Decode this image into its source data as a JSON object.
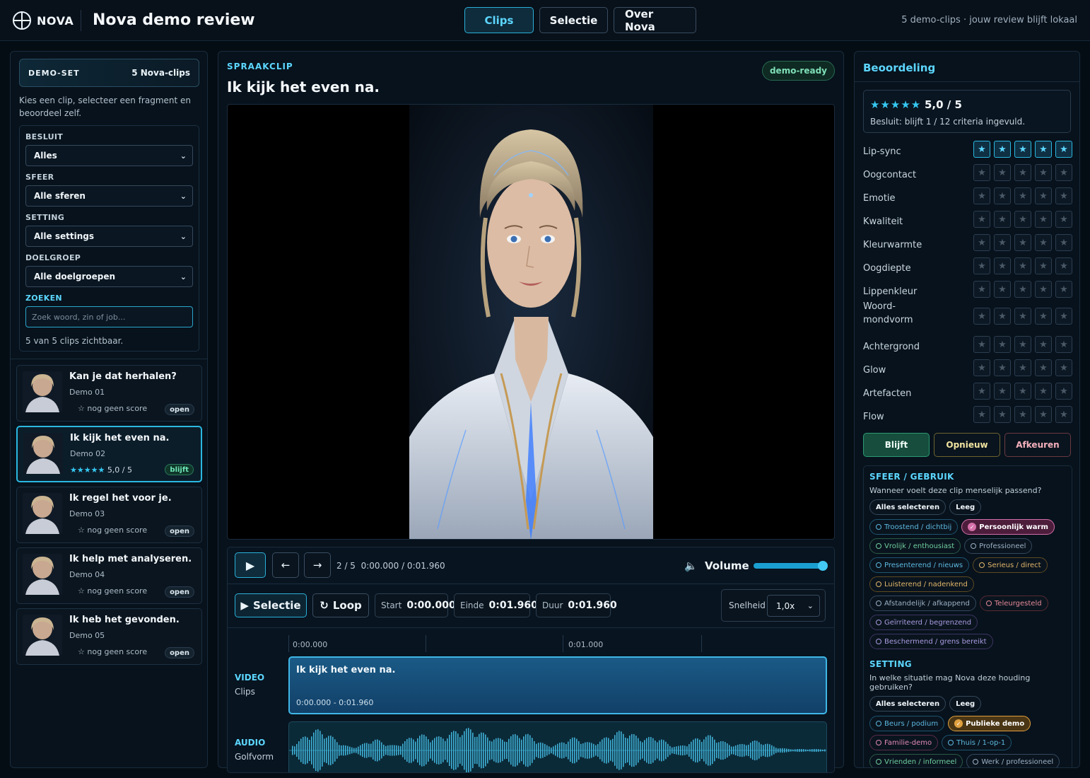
{
  "header": {
    "logo_text": "NOVA",
    "title": "Nova demo review",
    "nav": [
      "Clips",
      "Selectie",
      "Over Nova"
    ],
    "info": "5 demo-clips · jouw review blijft lokaal"
  },
  "sidebar": {
    "set_label": "DEMO-SET",
    "set_count": "5 Nova-clips",
    "intro": "Kies een clip, selecteer een fragment en beoordeel zelf.",
    "filters": [
      {
        "label": "BESLUIT",
        "value": "Alles"
      },
      {
        "label": "SFEER",
        "value": "Alle sferen"
      },
      {
        "label": "SETTING",
        "value": "Alle settings"
      },
      {
        "label": "DOELGROEP",
        "value": "Alle doelgroepen"
      }
    ],
    "search_label": "ZOEKEN",
    "search_placeholder": "Zoek woord, zin of job...",
    "visible_count": "5 van 5 clips zichtbaar.",
    "clips": [
      {
        "title": "Kan je dat herhalen?",
        "sub": "Demo 01",
        "score": "nog geen score",
        "badge": "open"
      },
      {
        "title": "Ik kijk het even na.",
        "sub": "Demo 02",
        "score": "5,0 / 5",
        "badge": "blijft"
      },
      {
        "title": "Ik regel het voor je.",
        "sub": "Demo 03",
        "score": "nog geen score",
        "badge": "open"
      },
      {
        "title": "Ik help met analyseren.",
        "sub": "Demo 04",
        "score": "nog geen score",
        "badge": "open"
      },
      {
        "title": "Ik heb het gevonden.",
        "sub": "Demo 05",
        "score": "nog geen score",
        "badge": "open"
      }
    ]
  },
  "main": {
    "kicker": "SPRAAKCLIP",
    "title": "Ik kijk het even na.",
    "status": "demo-ready",
    "position": "2 / 5",
    "time": "0:00.000 / 0:01.960",
    "volume_label": "Volume",
    "volume_level": 1.0,
    "selection_label": "Selectie",
    "loop_label": "Loop",
    "start_label": "Start",
    "start_value": "0:00.000",
    "end_label": "Einde",
    "end_value": "0:01.960",
    "duration_label": "Duur",
    "duration_value": "0:01.960",
    "speed_label": "Snelheid",
    "speed_value": "1,0x",
    "ruler": [
      "0:00.000",
      "0:01.000"
    ],
    "video_track": {
      "label": "VIDEO",
      "sub": "Clips",
      "clip_title": "Ik kijk het even na.",
      "range": "0:00.000 - 0:01.960"
    },
    "audio_track": {
      "label": "AUDIO",
      "sub": "Golfvorm"
    }
  },
  "review": {
    "title": "Beoordeling",
    "stars": "★★★★★",
    "score": "5,0 / 5",
    "summary": "Besluit: blijft 1 / 12 criteria ingevuld.",
    "criteria": [
      {
        "name": "Lip-sync",
        "rating": 5
      },
      {
        "name": "Oogcontact",
        "rating": 0
      },
      {
        "name": "Emotie",
        "rating": 0
      },
      {
        "name": "Kwaliteit",
        "rating": 0
      },
      {
        "name": "Kleurwarmte",
        "rating": 0
      },
      {
        "name": "Oogdiepte",
        "rating": 0
      },
      {
        "name": "Lippenkleur",
        "rating": 0
      },
      {
        "name": "Woord-mondvorm",
        "rating": 0
      },
      {
        "name": "Achtergrond",
        "rating": 0
      },
      {
        "name": "Glow",
        "rating": 0
      },
      {
        "name": "Artefacten",
        "rating": 0
      },
      {
        "name": "Flow",
        "rating": 0
      }
    ],
    "decisions": [
      "Blijft",
      "Opnieuw",
      "Afkeuren"
    ],
    "mood": {
      "title": "SFEER / GEBRUIK",
      "question": "Wanneer voelt deze clip menselijk passend?",
      "select_all": "Alles selecteren",
      "clear": "Leeg",
      "tags": [
        {
          "label": "Troostend / dichtbij",
          "color": "blue",
          "selected": false
        },
        {
          "label": "Persoonlijk warm",
          "color": "pink",
          "selected": true
        },
        {
          "label": "Vrolijk / enthousiast",
          "color": "green",
          "selected": false
        },
        {
          "label": "Professioneel",
          "color": "slate",
          "selected": false
        },
        {
          "label": "Presenterend / nieuws",
          "color": "blue",
          "selected": false
        },
        {
          "label": "Serieus / direct",
          "color": "amber",
          "selected": false
        },
        {
          "label": "Luisterend / nadenkend",
          "color": "amber",
          "selected": false
        },
        {
          "label": "Afstandelijk / afkappend",
          "color": "slate",
          "selected": false
        },
        {
          "label": "Teleurgesteld",
          "color": "red",
          "selected": false
        },
        {
          "label": "Geïrriteerd / begrenzend",
          "color": "purple",
          "selected": false
        },
        {
          "label": "Beschermend / grens bereikt",
          "color": "purple",
          "selected": false
        }
      ]
    },
    "setting": {
      "title": "SETTING",
      "question": "In welke situatie mag Nova deze houding gebruiken?",
      "select_all": "Alles selecteren",
      "clear": "Leeg",
      "tags": [
        {
          "label": "Beurs / podium",
          "color": "blue",
          "selected": false
        },
        {
          "label": "Publieke demo",
          "color": "amber",
          "selected": true
        },
        {
          "label": "Familie-demo",
          "color": "pink",
          "selected": false
        },
        {
          "label": "Thuis / 1-op-1",
          "color": "blue",
          "selected": false
        },
        {
          "label": "Vrienden / informeel",
          "color": "green",
          "selected": false
        },
        {
          "label": "Werk / professioneel",
          "color": "slate",
          "selected": false
        }
      ]
    }
  },
  "colors": {
    "accent": "#5cd6ff",
    "keep": "#164d3c",
    "selected_border": "#2ab8e0"
  }
}
